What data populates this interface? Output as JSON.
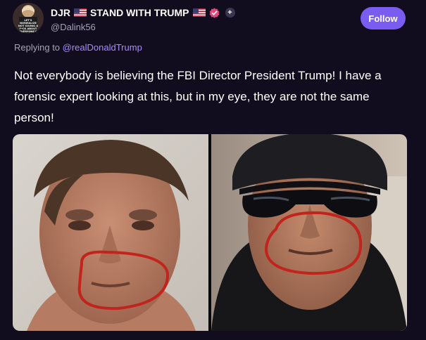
{
  "author": {
    "display_name": "DJR",
    "display_suffix": "STAND WITH TRUMP",
    "handle": "@Dalink56",
    "avatar_text": "LET'S NORMALIZE NOT GIVING A F*CK ABOUT EVERYONE'S"
  },
  "follow_label": "Follow",
  "reply": {
    "prefix": "Replying to ",
    "target": "@realDonaldTrump"
  },
  "post_text": "Not everybody is believing the FBI Director President Trump! I have a forensic expert looking at this, but in my eye, they are not the same person!",
  "colors": {
    "background": "#110d1f",
    "accent": "#7b5cf0",
    "link": "#a58cff",
    "muted": "#a5a1b8",
    "verified": "#e2487a",
    "circle_marker": "#c0241d"
  }
}
